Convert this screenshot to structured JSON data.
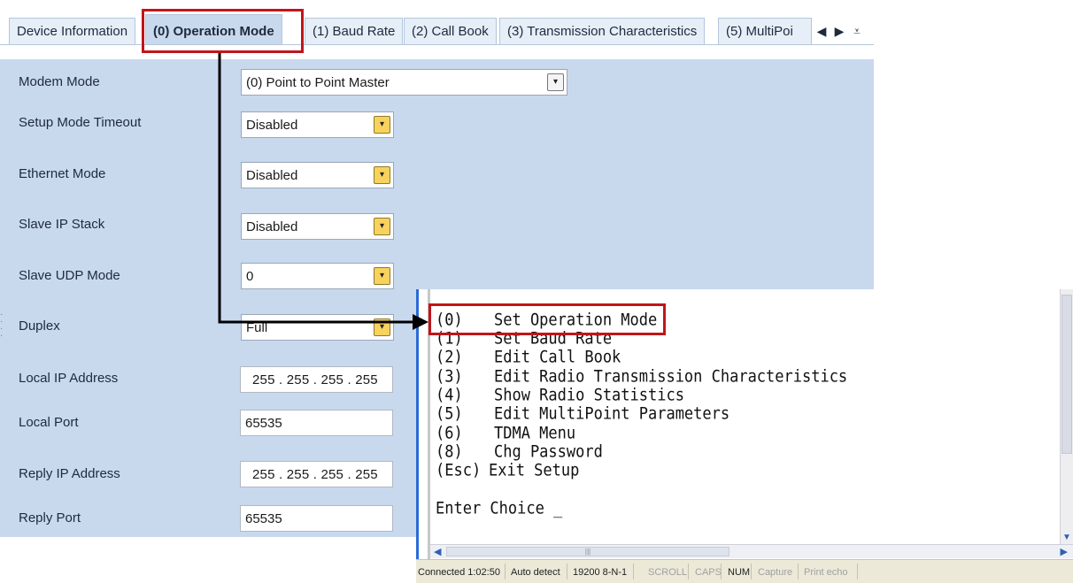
{
  "tabs": [
    {
      "label": "Device Information",
      "active": false
    },
    {
      "label": "(0) Operation Mode",
      "active": true
    },
    {
      "label": "(1) Baud Rate",
      "active": false
    },
    {
      "label": "(2) Call Book",
      "active": false
    },
    {
      "label": "(3) Transmission Characteristics",
      "active": false
    },
    {
      "label": "(5) MultiPoi",
      "active": false
    }
  ],
  "tab_nav": {
    "left": "◀",
    "right": "▶",
    "menu": "⩡"
  },
  "fields": {
    "modem_mode": {
      "label": "Modem Mode",
      "value": "(0) Point to Point Master"
    },
    "setup_mode_timeout": {
      "label": "Setup Mode Timeout",
      "value": "Disabled"
    },
    "ethernet_mode": {
      "label": "Ethernet Mode",
      "value": "Disabled"
    },
    "slave_ip_stack": {
      "label": "Slave IP Stack",
      "value": "Disabled"
    },
    "slave_udp_mode": {
      "label": "Slave UDP Mode",
      "value": "0"
    },
    "duplex": {
      "label": "Duplex",
      "value": "Full"
    },
    "local_ip": {
      "label": "Local IP Address",
      "value": "255 . 255 . 255 . 255"
    },
    "local_port": {
      "label": "Local Port",
      "value": "65535"
    },
    "reply_ip": {
      "label": "Reply IP Address",
      "value": "255 . 255 . 255 . 255"
    },
    "reply_port": {
      "label": "Reply Port",
      "value": "65535"
    }
  },
  "terminal": {
    "menu": [
      {
        "key": "(0)",
        "text": "Set Operation Mode"
      },
      {
        "key": "(1)",
        "text": "Set Baud Rate"
      },
      {
        "key": "(2)",
        "text": "Edit Call Book"
      },
      {
        "key": "(3)",
        "text": "Edit Radio Transmission Characteristics"
      },
      {
        "key": "(4)",
        "text": "Show Radio Statistics"
      },
      {
        "key": "(5)",
        "text": "Edit MultiPoint Parameters"
      },
      {
        "key": "(6)",
        "text": "TDMA Menu"
      },
      {
        "key": "(8)",
        "text": "Chg Password"
      },
      {
        "key": "(Esc)",
        "text": "Exit Setup"
      }
    ],
    "prompt": "Enter Choice _"
  },
  "statusbar": {
    "connected": "Connected 1:02:50",
    "detect": "Auto detect",
    "settings": "19200 8-N-1",
    "scroll": "SCROLL",
    "caps": "CAPS",
    "num": "NUM",
    "capture": "Capture",
    "print_echo": "Print echo"
  },
  "colors": {
    "panel_bg": "#c8d9ee",
    "highlight_red": "#c0151b",
    "dropdown_yellow": "#f7d25c"
  }
}
